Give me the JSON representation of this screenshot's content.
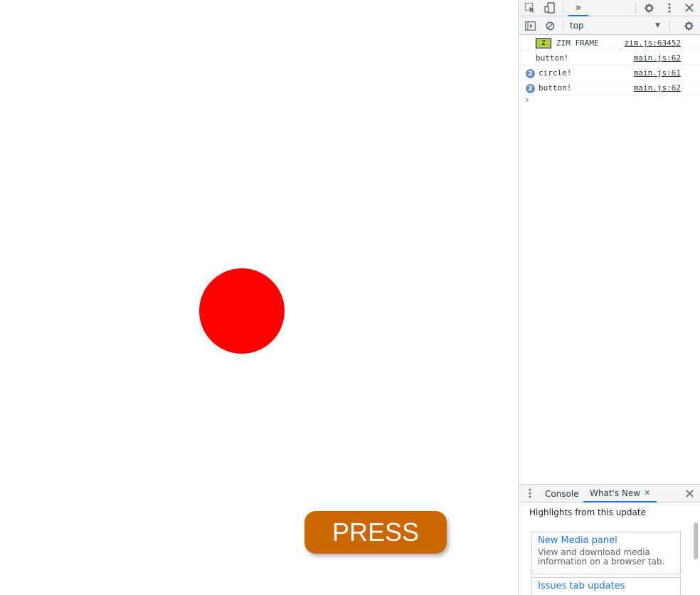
{
  "stage": {
    "circle_color": "#ff0000",
    "button": {
      "label": "PRESS",
      "color": "#cc6600"
    }
  },
  "devtools": {
    "toolbar": {
      "icons": [
        "inspect-element-icon",
        "device-toolbar-icon",
        "more-tabs-icon",
        "settings-icon",
        "kebab-menu-icon",
        "close-icon"
      ],
      "more_tabs_glyph": "»"
    },
    "console_toolbar": {
      "context": "top",
      "icons": [
        "sidebar-toggle-icon",
        "clear-console-icon",
        "console-settings-icon"
      ]
    },
    "messages": [
      {
        "badge": "Z",
        "text": "ZIM FRAME",
        "source": "zim.js:63452"
      },
      {
        "text": "button!",
        "source": "main.js:62"
      },
      {
        "count": "2",
        "text": "circle!",
        "source": "main.js:61"
      },
      {
        "count": "2",
        "text": "button!",
        "source": "main.js:62"
      }
    ],
    "prompt": "›",
    "drawer": {
      "tabs": [
        {
          "label": "Console",
          "active": false
        },
        {
          "label": "What's New",
          "active": true
        }
      ],
      "heading": "Highlights from this update",
      "cards": [
        {
          "title": "New Media panel",
          "description": "View and download media information on a browser tab."
        },
        {
          "title": "Issues tab updates",
          "description": ""
        }
      ]
    }
  }
}
